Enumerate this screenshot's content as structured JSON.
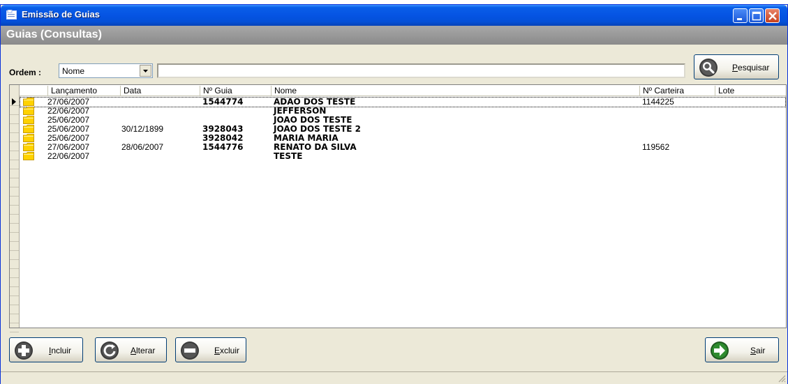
{
  "window": {
    "title": "Emissão de Guias",
    "section_title": "Guias (Consultas)"
  },
  "filter": {
    "order_label": "Ordem :",
    "order_value": "Nome",
    "search_value": "",
    "search_button": "Pesquisar"
  },
  "grid": {
    "columns": [
      "Lançamento",
      "Data",
      "Nº Guia",
      "Nome",
      "Nº Carteira",
      "Lote"
    ],
    "rows": [
      {
        "lancamento": "27/06/2007",
        "data": "",
        "guia": "1544774",
        "nome": "ADAO DOS TESTE",
        "carteira": "1144225",
        "lote": ""
      },
      {
        "lancamento": "22/06/2007",
        "data": "",
        "guia": "",
        "nome": "JEFFERSON",
        "carteira": "",
        "lote": ""
      },
      {
        "lancamento": "25/06/2007",
        "data": "",
        "guia": "",
        "nome": "JOAO DOS TESTE",
        "carteira": "",
        "lote": ""
      },
      {
        "lancamento": "25/06/2007",
        "data": "30/12/1899",
        "guia": "3928043",
        "nome": "JOAO DOS TESTE 2",
        "carteira": "",
        "lote": ""
      },
      {
        "lancamento": "25/06/2007",
        "data": "",
        "guia": "3928042",
        "nome": "MARIA MARIA",
        "carteira": "",
        "lote": ""
      },
      {
        "lancamento": "27/06/2007",
        "data": "28/06/2007",
        "guia": "1544776",
        "nome": "RENATO DA SILVA",
        "carteira": "119562",
        "lote": ""
      },
      {
        "lancamento": "22/06/2007",
        "data": "",
        "guia": "",
        "nome": "TESTE",
        "carteira": "",
        "lote": ""
      }
    ]
  },
  "actions": {
    "incluir": {
      "key": "I",
      "rest": "ncluir"
    },
    "alterar": {
      "key": "A",
      "rest": "lterar"
    },
    "excluir": {
      "key": "E",
      "rest": "xcluir"
    },
    "sair": {
      "key": "S",
      "rest": "air"
    },
    "pesquisar": {
      "key": "P",
      "rest": "esquisar"
    }
  },
  "icons": {
    "app": "window-icon",
    "row": "folder-icon",
    "pointer": "row-pointer-icon"
  },
  "colors": {
    "titlebar": "#0554e3",
    "header_band": "#999999",
    "folder": "#ffd200"
  }
}
